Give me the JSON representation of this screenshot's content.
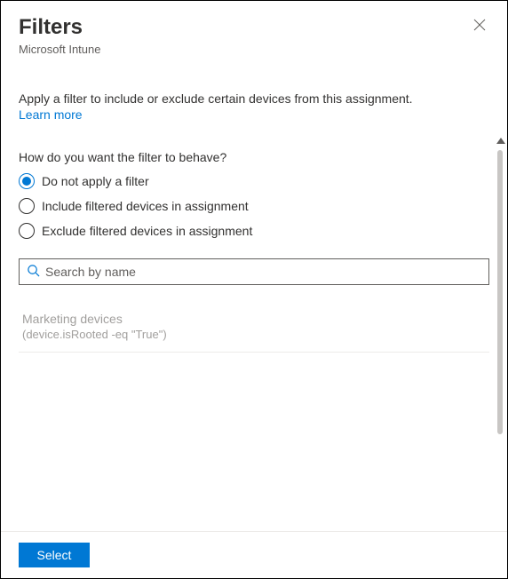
{
  "header": {
    "title": "Filters",
    "subtitle": "Microsoft Intune"
  },
  "description": "Apply a filter to include or exclude certain devices from this assignment.",
  "learn_more": "Learn more",
  "question": "How do you want the filter to behave?",
  "radio_options": [
    {
      "label": "Do not apply a filter",
      "selected": true
    },
    {
      "label": "Include filtered devices in assignment",
      "selected": false
    },
    {
      "label": "Exclude filtered devices in assignment",
      "selected": false
    }
  ],
  "search": {
    "placeholder": "Search by name",
    "value": ""
  },
  "filters": [
    {
      "name": "Marketing devices",
      "rule": "(device.isRooted -eq \"True\")"
    }
  ],
  "footer": {
    "select_label": "Select"
  }
}
